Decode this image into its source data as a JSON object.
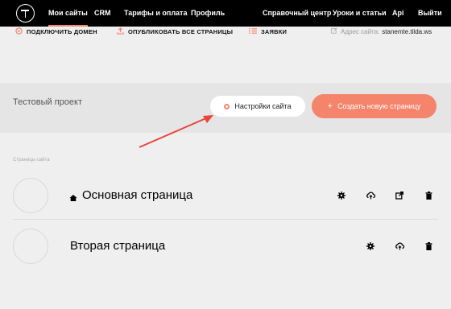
{
  "nav": {
    "items": [
      {
        "label": "Мои сайты",
        "active": true
      },
      {
        "label": "CRM"
      },
      {
        "label": "Тарифы и оплата"
      },
      {
        "label": "Профиль"
      }
    ],
    "right_items": [
      {
        "label": "Справочный центр"
      },
      {
        "label": "Уроки и статьи"
      },
      {
        "label": "Api"
      },
      {
        "label": "Выйти"
      }
    ]
  },
  "actions": {
    "connect_domain": "ПОДКЛЮЧИТЬ ДОМЕН",
    "publish_all": "ОПУБЛИКОВАТЬ ВСЕ СТРАНИЦЫ",
    "requests": "ЗАЯВКИ",
    "site_address_label": "Адрес сайта:",
    "site_address_value": "stanemte.tilda.ws"
  },
  "project": {
    "title": "Тестовый проект",
    "settings_button": "Настройки сайта",
    "create_page_button": "Создать новую страницу"
  },
  "pages": {
    "section_label": "Страницы сайта",
    "items": [
      {
        "title": "Основная страница",
        "is_home": true
      },
      {
        "title": "Вторая страница",
        "is_home": false
      }
    ]
  },
  "colors": {
    "accent": "#f4846b",
    "nav_bg": "#000000",
    "annotation_arrow": "#e8453c"
  },
  "icons": {
    "logo": "tilda-logo-icon",
    "connect_domain": "globe-icon",
    "publish_all": "upload-icon",
    "requests": "list-icon",
    "site_address": "edit-icon",
    "settings": "gear-icon",
    "publish": "cloud-upload-icon",
    "open": "external-link-icon",
    "delete": "trash-icon",
    "home": "home-icon"
  }
}
